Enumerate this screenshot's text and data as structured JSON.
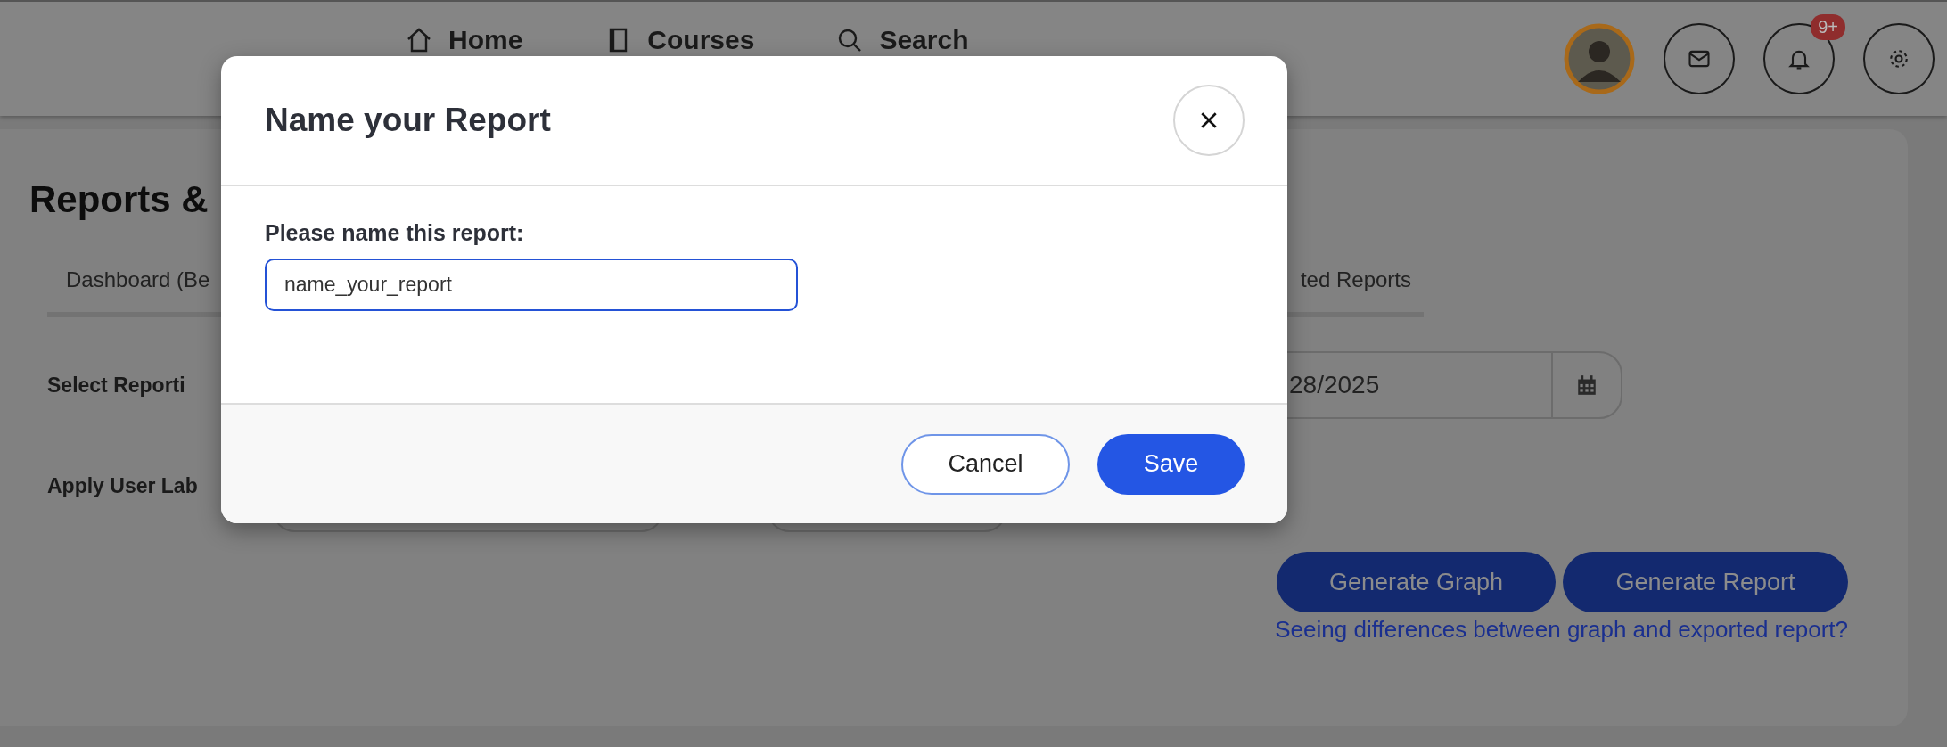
{
  "header": {
    "nav": [
      {
        "kind": "home",
        "label": "Home"
      },
      {
        "kind": "courses",
        "label": "Courses"
      },
      {
        "kind": "search",
        "label": "Search"
      }
    ],
    "notifications_badge": "9+"
  },
  "page": {
    "title": "Reports &",
    "tabs": [
      {
        "label": "Dashboard (Be",
        "selected": false
      },
      {
        "label": "ted Reports",
        "selected": false
      }
    ],
    "reporting_period": {
      "label": "Select Reporti",
      "end_date": "28/2025"
    },
    "user_labels": {
      "label": "Apply User Lab"
    },
    "buttons": [
      "Generate Graph",
      "Generate Report"
    ],
    "help_link": "Seeing differences between graph and exported report?"
  },
  "dialog": {
    "title": "Name your Report",
    "field_label": "Please name this report:",
    "field_value": "name_your_report",
    "buttons": [
      {
        "kind": "secondary",
        "label": "Cancel"
      },
      {
        "kind": "primary",
        "label": "Save"
      }
    ]
  }
}
